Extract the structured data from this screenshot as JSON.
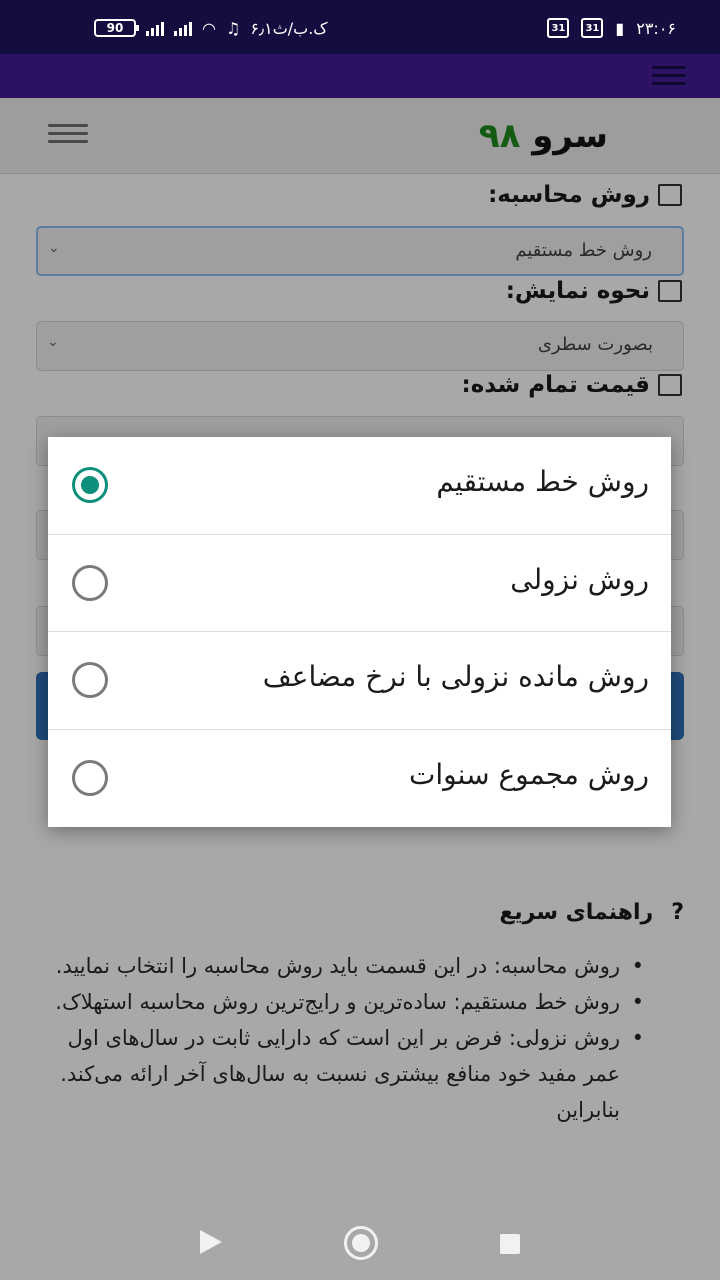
{
  "status_bar": {
    "time": "۲۳:۰۶",
    "calendar_badges": [
      "31",
      "31"
    ],
    "battery": "90",
    "speed": "۶٫۱ک.ب/ث"
  },
  "site": {
    "logo_text": "سرو",
    "logo_number": "۹۸"
  },
  "form": {
    "method_label": "روش محاسبه:",
    "method_value": "روش خط مستقیم",
    "display_label": "نحوه نمایش:",
    "display_value": "بصورت سطری",
    "price_label": "قیمت تمام شده:"
  },
  "dialog": {
    "options": [
      {
        "label": "روش خط مستقیم",
        "selected": true
      },
      {
        "label": "روش نزولی",
        "selected": false
      },
      {
        "label": "روش مانده نزولی با نرخ مضاعف",
        "selected": false
      },
      {
        "label": "روش مجموع سنوات",
        "selected": false
      }
    ],
    "accent_color": "#0d8f7c"
  },
  "help": {
    "title": "راهنمای سریع",
    "icon": "?",
    "items": [
      "روش محاسبه: در این قسمت باید روش محاسبه را انتخاب نمایید.",
      "روش خط مستقیم: ساده‌ترین و رایج‌ترین روش محاسبه استهلاک.",
      "روش نزولی: فرض بر این است که دارایی ثابت در سال‌های اول عمر مفید خود منافع بیشتری نسبت به سال‌های آخر ارائه می‌کند. بنابراین"
    ]
  }
}
